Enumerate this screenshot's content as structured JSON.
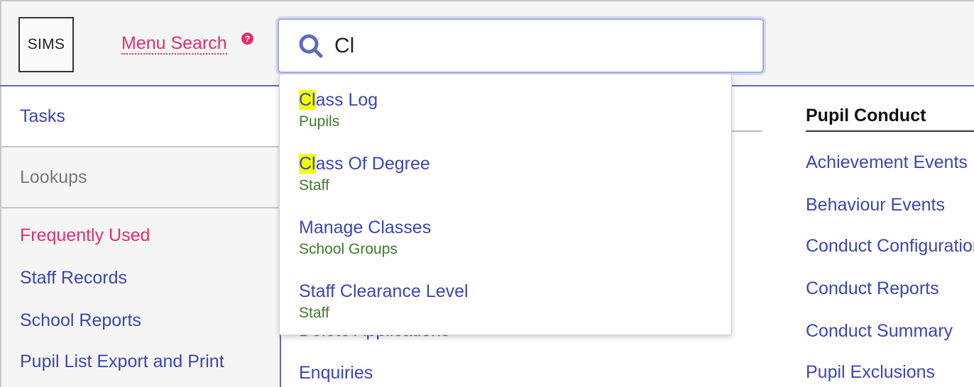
{
  "header": {
    "logo_text": "SIMS",
    "menu_search_label": "Menu Search",
    "help_glyph": "?",
    "search": {
      "value": "Cl",
      "icon": "search-icon"
    }
  },
  "sidebar": {
    "tasks_label": "Tasks",
    "lookups_label": "Lookups",
    "links": [
      {
        "label": "Frequently Used",
        "active": true
      },
      {
        "label": "Staff Records"
      },
      {
        "label": "School Reports"
      },
      {
        "label": "Pupil List Export and Print"
      }
    ]
  },
  "main": {
    "links": [
      {
        "label": "Delete Applications"
      },
      {
        "label": "Enquiries"
      }
    ]
  },
  "right_column": {
    "heading": "Pupil Conduct",
    "links": [
      {
        "label": "Achievement Events"
      },
      {
        "label": "Behaviour Events"
      },
      {
        "label": "Conduct Configuration"
      },
      {
        "label": "Conduct Reports"
      },
      {
        "label": "Conduct Summary"
      },
      {
        "label": "Pupil Exclusions"
      }
    ]
  },
  "dropdown": {
    "results": [
      {
        "match": "Cl",
        "rest": "ass Log",
        "category": "Pupils"
      },
      {
        "match": "Cl",
        "rest": "ass Of Degree",
        "category": "Staff"
      },
      {
        "match": "",
        "rest": "Manage Classes",
        "category": "School Groups"
      },
      {
        "match": "",
        "rest": "Staff Clearance Level",
        "category": "Staff"
      }
    ]
  },
  "colors": {
    "link": "#3a47b0",
    "accent_pink": "#e0306e",
    "category_green": "#3f7a2a",
    "highlight": "#f5ff00"
  }
}
